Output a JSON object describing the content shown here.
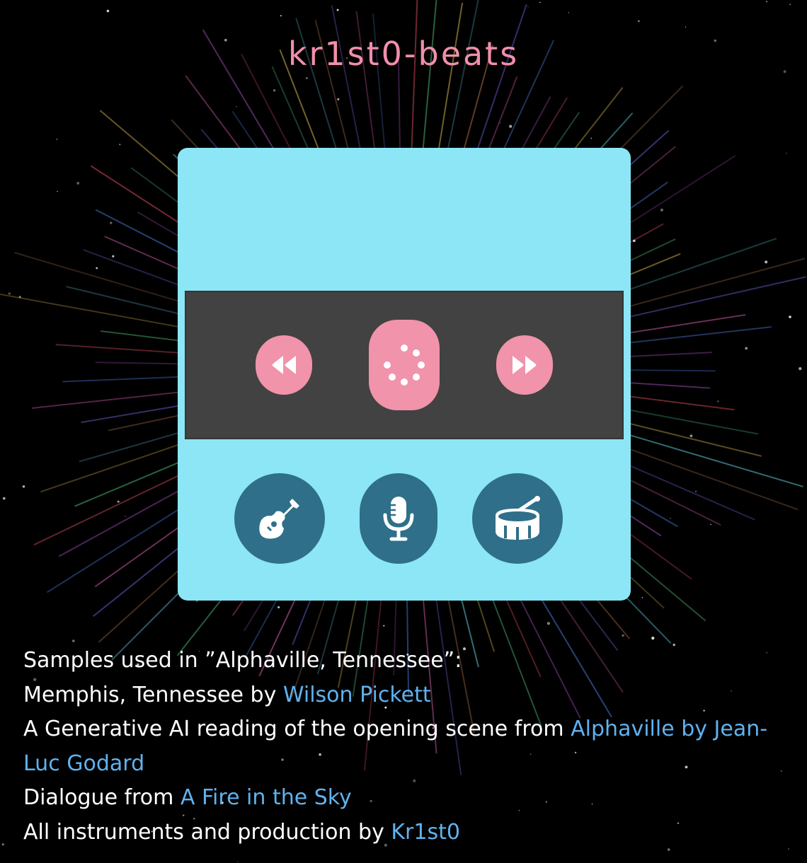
{
  "app": {
    "title": "kr1st0-beats"
  },
  "colors": {
    "background": "#000000",
    "title": "#f08fab",
    "panel": "#8ce6f5",
    "controls_bar": "#424242",
    "control_button": "#f093ab",
    "control_icon": "#ffffff",
    "instrument_button": "#2f6f89",
    "link": "#5fb2ef"
  },
  "player": {
    "controls": {
      "prev_icon": "rewind-icon",
      "play_icon": "loading-dots-icon",
      "next_icon": "fast-forward-icon"
    },
    "instruments": [
      {
        "name": "guitar",
        "icon": "guitar-icon"
      },
      {
        "name": "vocals",
        "icon": "microphone-icon"
      },
      {
        "name": "drums",
        "icon": "drum-icon"
      }
    ]
  },
  "credits": {
    "heading": "Samples used in ”Alphaville, Tennessee”:",
    "line1_text": "Memphis, Tennessee by ",
    "line1_link": "Wilson Pickett",
    "line2_text": "A Generative AI reading of the opening scene from ",
    "line2_link": "Alphaville by Jean-Luc Godard",
    "line3_text": "Dialogue from ",
    "line3_link": "A Fire in the Sky",
    "line4_text": "All instruments and production by ",
    "line4_link": "Kr1st0"
  }
}
